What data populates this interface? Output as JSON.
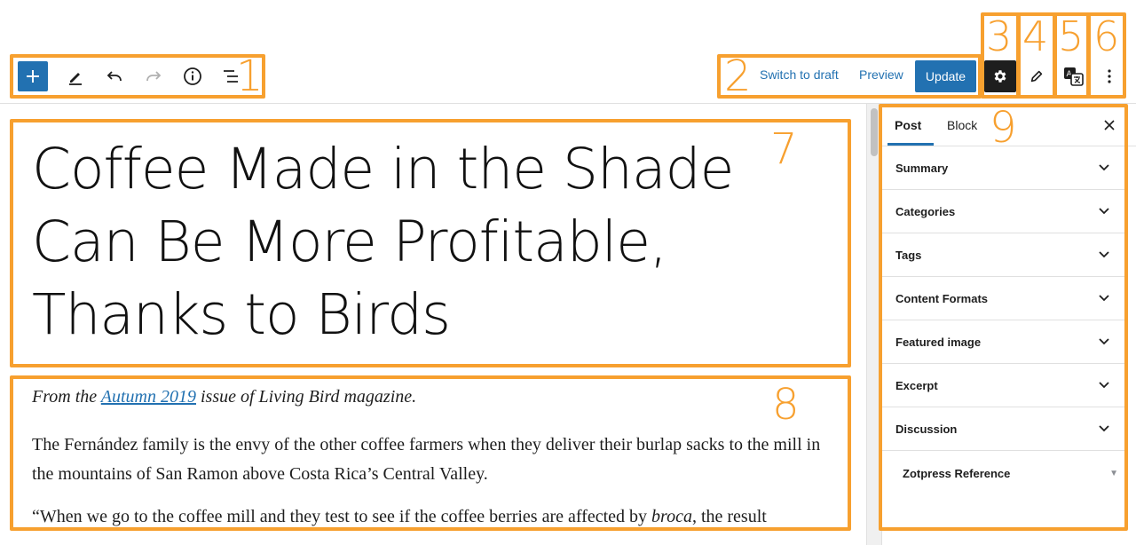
{
  "toolbar": {
    "add_icon": "plus-icon",
    "tools_icon": "pencil-icon",
    "undo_icon": "undo-icon",
    "redo_icon": "redo-icon",
    "details_icon": "info-icon",
    "outline_icon": "list-view-icon",
    "switch_to_draft": "Switch to draft",
    "preview": "Preview",
    "update": "Update",
    "settings_icon": "gear-icon",
    "edit_icon": "pencil-icon",
    "translate_icon": "translate-icon",
    "more_icon": "vertical-ellipsis-icon"
  },
  "editor": {
    "title": "Coffee Made in the Shade Can Be More Profitable, Thanks to Birds",
    "p1_pre": "From the ",
    "p1_link": "Autumn 2019",
    "p1_post": " issue of Living Bird magazine.",
    "p2": "The Fernández family is the envy of the other coffee farmers when they deliver their burlap sacks to the mill in the mountains of San Ramon above Costa Rica’s Central Valley.",
    "p3_pre": "“When we go to the coffee mill and they test to see if the coffee berries are affected by ",
    "p3_em": "broca",
    "p3_post": ", the result"
  },
  "sidebar": {
    "tab_post": "Post",
    "tab_block": "Block",
    "panels": [
      "Summary",
      "Categories",
      "Tags",
      "Content Formats",
      "Featured image",
      "Excerpt",
      "Discussion"
    ],
    "zotpress": "Zotpress Reference",
    "zotpress_arrow": "▼"
  },
  "annotations": [
    "1",
    "2",
    "3",
    "4",
    "5",
    "6",
    "7",
    "8",
    "9"
  ],
  "colors": {
    "annotation": "#f7a02f",
    "accent": "#2271b1"
  }
}
